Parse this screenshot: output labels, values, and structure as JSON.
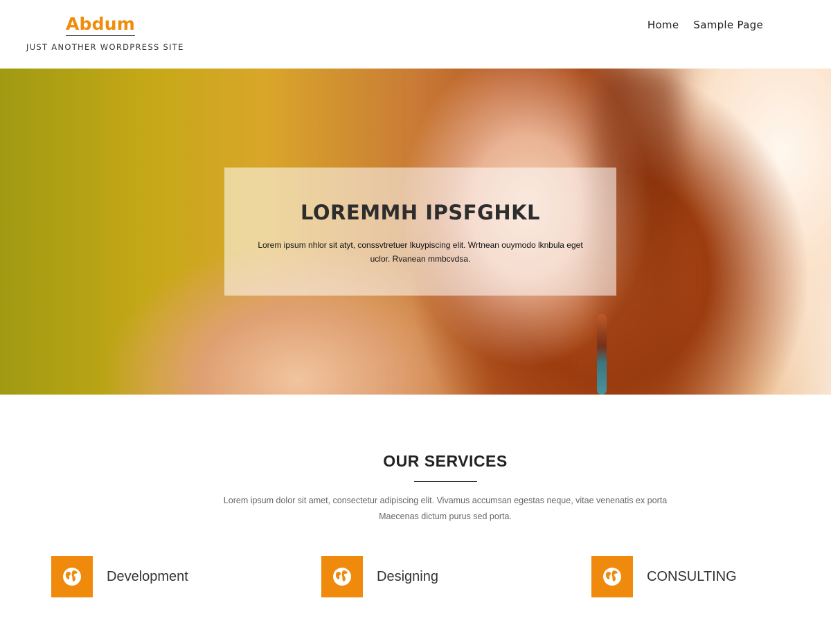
{
  "colors": {
    "accent": "#f08a0c",
    "text_dark": "#222222",
    "text_muted": "#666666"
  },
  "header": {
    "site_title": "Abdum",
    "site_description": "JUST ANOTHER WORDPRESS SITE",
    "nav": [
      {
        "label": "Home"
      },
      {
        "label": "Sample Page"
      }
    ]
  },
  "hero": {
    "title": "LOREMMH IPSFGHKL",
    "text": "Lorem ipsum nhlor sit atyt, conssvtretuer lkuypiscing elit. Wrtnean ouymodo lknbula eget uclor. Rvanean mmbcvdsa."
  },
  "services": {
    "title": "OUR SERVICES",
    "description": "Lorem ipsum dolor sit amet, consectetur adipiscing elit. Vivamus accumsan egestas neque, vitae venenatis ex porta Maecenas dictum purus sed porta.",
    "items": [
      {
        "label": "Development",
        "icon": "globe-icon"
      },
      {
        "label": "Designing",
        "icon": "globe-icon"
      },
      {
        "label": "CONSULTING",
        "icon": "globe-icon"
      }
    ]
  }
}
